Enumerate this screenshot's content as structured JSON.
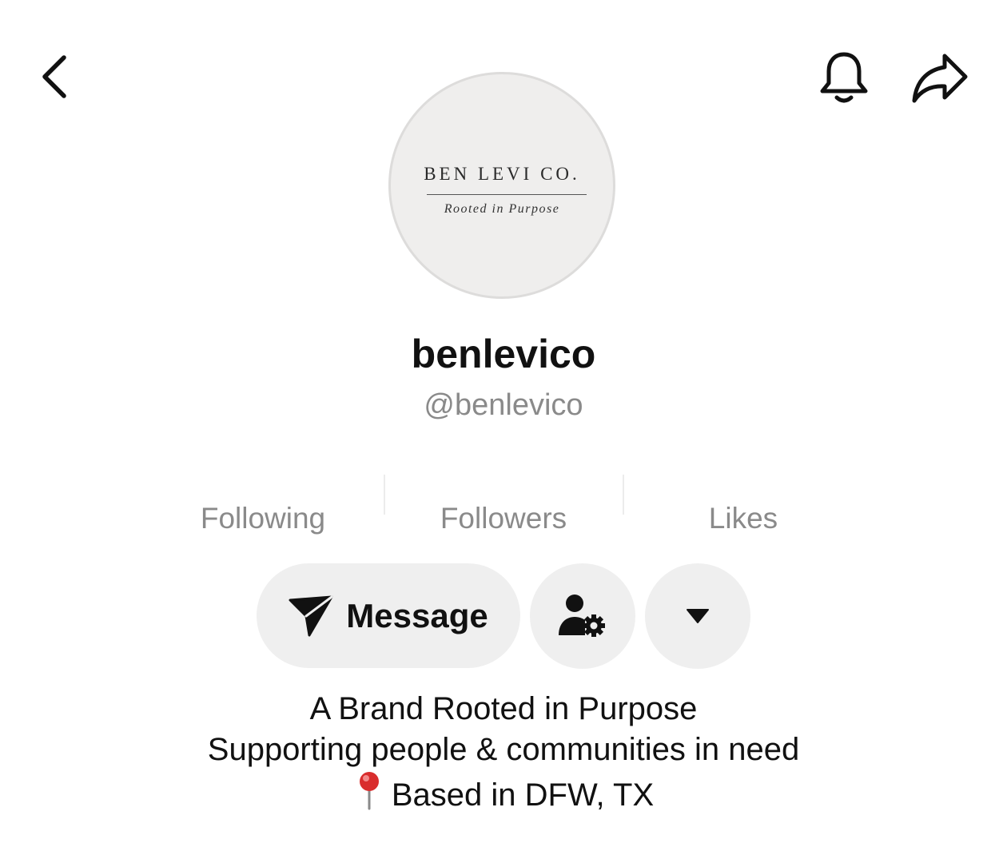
{
  "header": {
    "back_icon": "chevron-left-icon",
    "notification_icon": "bell-icon",
    "share_icon": "share-arrow-icon"
  },
  "avatar": {
    "logo_title": "BEN LEVI CO.",
    "logo_tagline": "Rooted in Purpose",
    "background_color": "#efeeed"
  },
  "profile": {
    "display_name": "benlevico",
    "handle": "@benlevico"
  },
  "stats": {
    "following_label": "Following",
    "followers_label": "Followers",
    "likes_label": "Likes"
  },
  "actions": {
    "message_label": "Message",
    "message_icon": "send-icon",
    "follow_settings_icon": "user-gear-icon",
    "more_icon": "caret-down-icon"
  },
  "bio": {
    "line1": "A Brand Rooted in Purpose",
    "line2": "Supporting people & communities in need",
    "line3": "Based in DFW, TX",
    "line3_icon": "pushpin-icon"
  },
  "colors": {
    "button_bg": "#efefef",
    "muted_text": "#8a8a8a",
    "primary_text": "#111111"
  }
}
